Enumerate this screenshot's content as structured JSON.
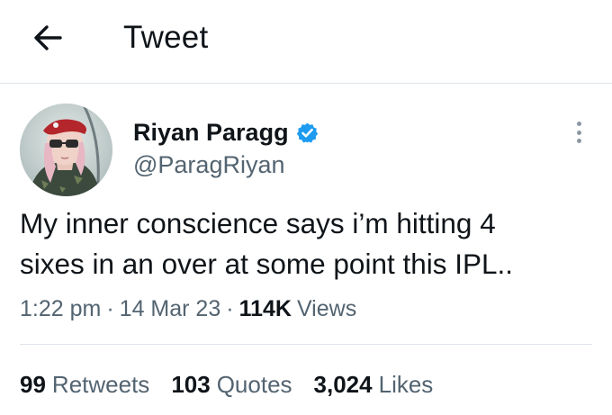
{
  "header": {
    "title": "Tweet",
    "back_icon": "arrow-left-icon"
  },
  "author": {
    "name": "Riyan Paragg",
    "handle": "@ParagRiyan",
    "verified": true,
    "verified_color": "#1d9bf0",
    "more_icon": "more-vertical-icon"
  },
  "tweet": {
    "text_line1": "My inner conscience says i’m hitting 4",
    "text_line2": "sixes in an over at some point this IPL..",
    "time": "1:22 pm",
    "separator1": "·",
    "date": "14 Mar 23",
    "separator2": "·",
    "views_count": "114K",
    "views_label": "Views"
  },
  "stats": {
    "retweets_count": "99",
    "retweets_label": "Retweets",
    "quotes_count": "103",
    "quotes_label": "Quotes",
    "likes_count": "3,024",
    "likes_label": "Likes"
  },
  "colors": {
    "text_primary": "#0f1419",
    "text_secondary": "#536471",
    "divider": "#dfe5ea"
  }
}
